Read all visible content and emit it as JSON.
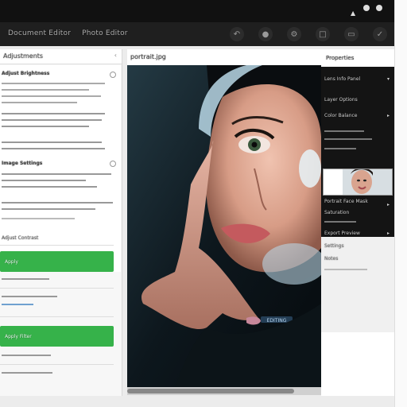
{
  "titlebar": {
    "time": ""
  },
  "toolbar": {
    "tabs": [
      "Document Editor",
      "Photo Editor"
    ],
    "icons": [
      "undo-icon",
      "palette-icon",
      "settings-icon",
      "image-icon",
      "layers-icon",
      "check-icon"
    ]
  },
  "left_panel": {
    "label": "Adjustments",
    "chevron": "‹",
    "green_buttons": [
      "Apply",
      "Apply Filter"
    ],
    "items": [
      "Adjust Brightness",
      "Image Settings",
      "Adjust Contrast"
    ]
  },
  "viewer": {
    "filename": "portrait.jpg",
    "overlay_label": "EDITING"
  },
  "right_panel": {
    "title": "Properties",
    "lines": [
      "Lens Info Panel",
      "Layer Options",
      "Color Balance",
      "Portrait Face Mask",
      "Saturation",
      "Export Preview",
      "Settings",
      "Notes"
    ]
  },
  "colors": {
    "accent": "#36b24a",
    "dark": "#141414"
  }
}
